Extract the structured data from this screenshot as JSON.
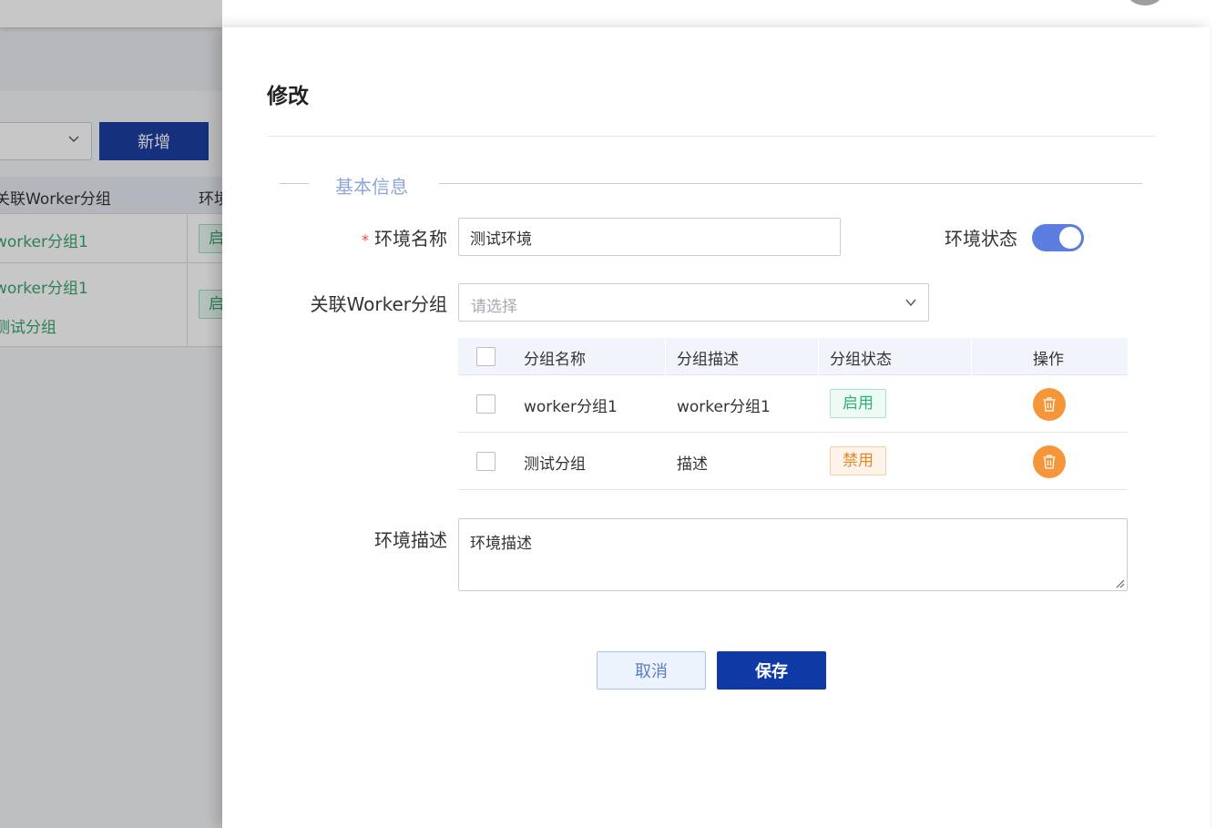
{
  "background": {
    "add_button_label": "新增",
    "table": {
      "headers": [
        "关联Worker分组",
        "环境"
      ],
      "rows": [
        {
          "groups": [
            "worker分组1"
          ],
          "status": "启"
        },
        {
          "groups": [
            "worker分组1",
            "测试分组"
          ],
          "status": "启"
        }
      ]
    }
  },
  "drawer": {
    "title": "修改",
    "section_title": "基本信息",
    "env_name": {
      "required_mark": "*",
      "label": "环境名称",
      "value": "测试环境"
    },
    "env_status": {
      "label": "环境状态",
      "enabled": true
    },
    "worker_group": {
      "label": "关联Worker分组",
      "placeholder": "请选择"
    },
    "group_table": {
      "headers": [
        "分组名称",
        "分组描述",
        "分组状态",
        "操作"
      ],
      "rows": [
        {
          "name": "worker分组1",
          "description": "worker分组1",
          "status": "启用",
          "status_type": "enabled"
        },
        {
          "name": "测试分组",
          "description": "描述",
          "status": "禁用",
          "status_type": "disabled"
        }
      ]
    },
    "env_desc": {
      "label": "环境描述",
      "value": "环境描述"
    },
    "cancel_label": "取消",
    "save_label": "保存"
  },
  "colors": {
    "primary": "#0f3aa6",
    "switch_on": "#5b7de0",
    "enabled_green": "#2fb174",
    "disabled_orange": "#e08a2c",
    "delete_orange": "#f5963a",
    "section_blue": "#8fa6d8"
  },
  "icons": {
    "delete": "trash-icon",
    "dropdown": "chevron-down-icon"
  }
}
